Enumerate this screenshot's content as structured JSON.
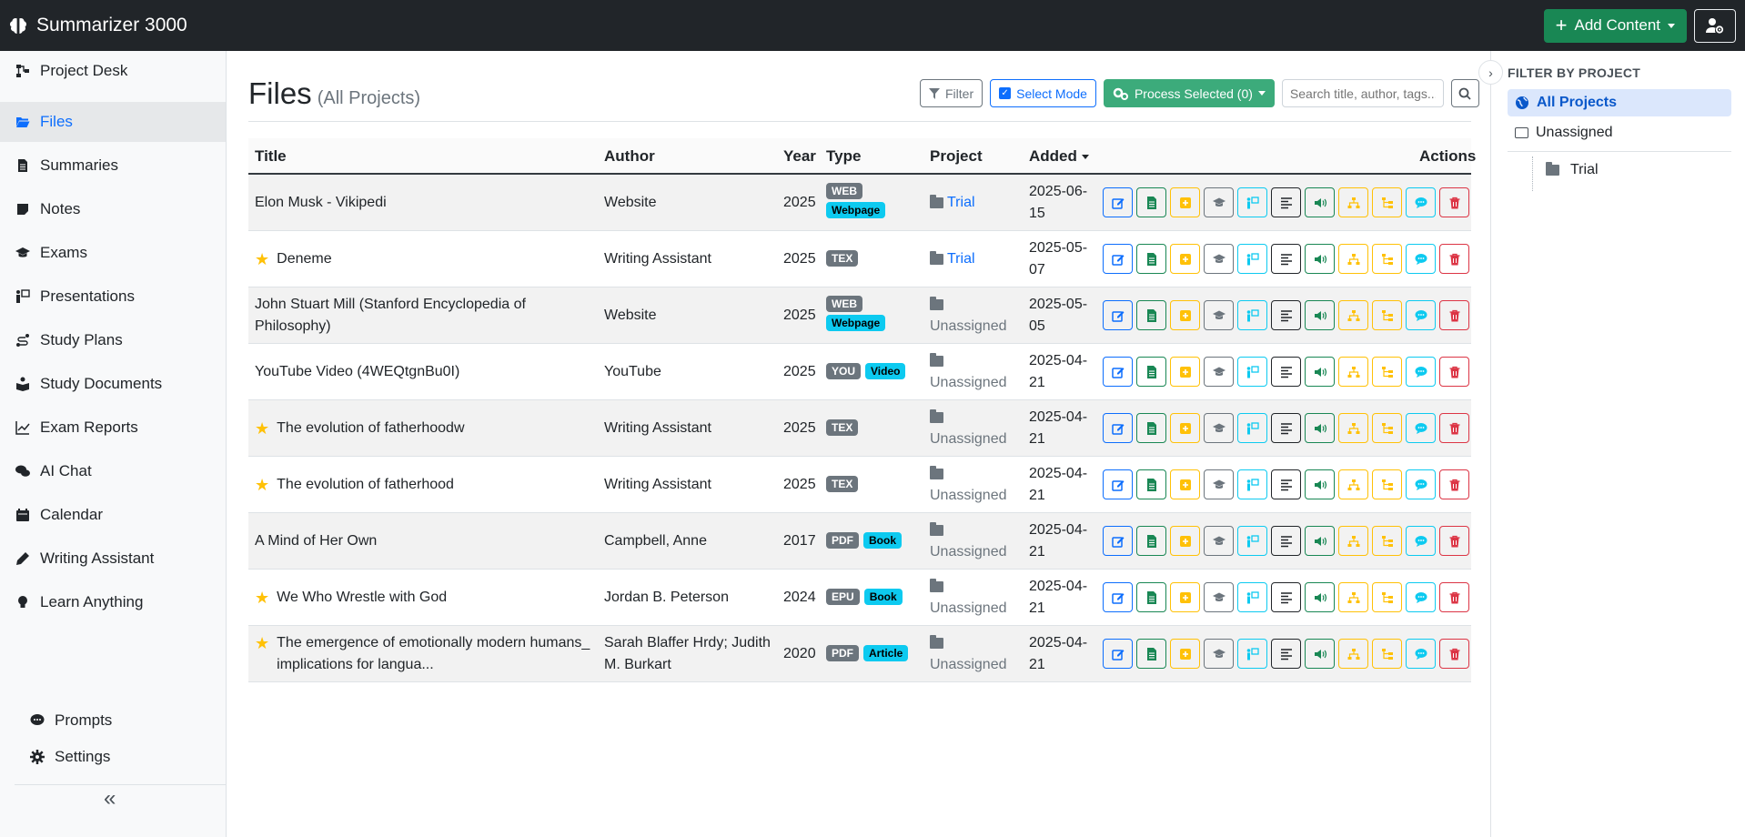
{
  "app": {
    "title": "Summarizer 3000",
    "add_content_label": "Add Content"
  },
  "sidebar": {
    "items": [
      {
        "label": "Project Desk",
        "icon": "diagram-icon"
      },
      {
        "label": "Files",
        "icon": "folder-open-icon",
        "active": true
      },
      {
        "label": "Summaries",
        "icon": "file-text-icon"
      },
      {
        "label": "Notes",
        "icon": "sticky-note-icon"
      },
      {
        "label": "Exams",
        "icon": "graduation-cap-icon"
      },
      {
        "label": "Presentations",
        "icon": "presentation-icon"
      },
      {
        "label": "Study Plans",
        "icon": "route-icon"
      },
      {
        "label": "Study Documents",
        "icon": "book-reader-icon"
      },
      {
        "label": "Exam Reports",
        "icon": "chart-line-icon"
      },
      {
        "label": "AI Chat",
        "icon": "comments-icon"
      },
      {
        "label": "Calendar",
        "icon": "calendar-icon"
      },
      {
        "label": "Writing Assistant",
        "icon": "pen-icon"
      },
      {
        "label": "Learn Anything",
        "icon": "lightbulb-icon"
      }
    ],
    "bottom": {
      "prompts": "Prompts",
      "settings": "Settings"
    }
  },
  "page": {
    "title": "Files",
    "subtitle": "(All Projects)"
  },
  "toolbar": {
    "filter_label": "Filter",
    "select_mode_label": "Select Mode",
    "process_label": "Process Selected (0)",
    "search_placeholder": "Search title, author, tags..."
  },
  "table": {
    "headers": {
      "title": "Title",
      "author": "Author",
      "year": "Year",
      "type": "Type",
      "project": "Project",
      "added": "Added",
      "actions": "Actions"
    },
    "rows": [
      {
        "title": "Elon Musk - Vikipedi",
        "starred": false,
        "author": "Website",
        "year": "2025",
        "badges": [
          {
            "text": "WEB",
            "style": "gray"
          },
          {
            "text": "Webpage",
            "style": "cyan"
          }
        ],
        "badge_layout": "stack",
        "project": "Trial",
        "project_linked": true,
        "added": "2025-06-15"
      },
      {
        "title": "Deneme",
        "starred": true,
        "author": "Writing Assistant",
        "year": "2025",
        "badges": [
          {
            "text": "TEX",
            "style": "gray"
          }
        ],
        "badge_layout": "row",
        "project": "Trial",
        "project_linked": true,
        "added": "2025-05-07"
      },
      {
        "title": "John Stuart Mill (Stanford Encyclopedia of Philosophy)",
        "starred": false,
        "author": "Website",
        "year": "2025",
        "badges": [
          {
            "text": "WEB",
            "style": "gray"
          },
          {
            "text": "Webpage",
            "style": "cyan"
          }
        ],
        "badge_layout": "stack",
        "project": "Unassigned",
        "project_linked": false,
        "added": "2025-05-05"
      },
      {
        "title": "YouTube Video (4WEQtgnBu0I)",
        "starred": false,
        "author": "YouTube",
        "year": "2025",
        "badges": [
          {
            "text": "YOU",
            "style": "gray"
          },
          {
            "text": "Video",
            "style": "cyan"
          }
        ],
        "badge_layout": "row",
        "project": "Unassigned",
        "project_linked": false,
        "added": "2025-04-21"
      },
      {
        "title": "The evolution of fatherhoodw",
        "starred": true,
        "author": "Writing Assistant",
        "year": "2025",
        "badges": [
          {
            "text": "TEX",
            "style": "gray"
          }
        ],
        "badge_layout": "row",
        "project": "Unassigned",
        "project_linked": false,
        "added": "2025-04-21"
      },
      {
        "title": "The evolution of fatherhood",
        "starred": true,
        "author": "Writing Assistant",
        "year": "2025",
        "badges": [
          {
            "text": "TEX",
            "style": "gray"
          }
        ],
        "badge_layout": "row",
        "project": "Unassigned",
        "project_linked": false,
        "added": "2025-04-21"
      },
      {
        "title": "A Mind of Her Own",
        "starred": false,
        "author": "Campbell, Anne",
        "year": "2017",
        "badges": [
          {
            "text": "PDF",
            "style": "gray"
          },
          {
            "text": "Book",
            "style": "cyan"
          }
        ],
        "badge_layout": "row",
        "project": "Unassigned",
        "project_linked": false,
        "added": "2025-04-21"
      },
      {
        "title": "We Who Wrestle with God",
        "starred": true,
        "author": "Jordan B. Peterson",
        "year": "2024",
        "badges": [
          {
            "text": "EPU",
            "style": "gray"
          },
          {
            "text": "Book",
            "style": "cyan"
          }
        ],
        "badge_layout": "row",
        "project": "Unassigned",
        "project_linked": false,
        "added": "2025-04-21"
      },
      {
        "title": "The emergence of emotionally modern humans_ implications for langua...",
        "starred": true,
        "author": "Sarah Blaffer Hrdy; Judith M. Burkart",
        "year": "2020",
        "badges": [
          {
            "text": "PDF",
            "style": "gray"
          },
          {
            "text": "Article",
            "style": "cyan"
          }
        ],
        "badge_layout": "row",
        "project": "Unassigned",
        "project_linked": false,
        "added": "2025-04-21"
      }
    ],
    "actions": [
      {
        "name": "edit-icon",
        "color": "#0d6efd"
      },
      {
        "name": "summary-icon",
        "color": "#198754"
      },
      {
        "name": "note-icon",
        "color": "#ffc107"
      },
      {
        "name": "exam-icon",
        "color": "#6c757d"
      },
      {
        "name": "presentation-icon",
        "color": "#0dcaf0"
      },
      {
        "name": "text-align-icon",
        "color": "#212529"
      },
      {
        "name": "audio-icon",
        "color": "#198754"
      },
      {
        "name": "mindmap-icon",
        "color": "#ffc107"
      },
      {
        "name": "outline-icon",
        "color": "#ffc107"
      },
      {
        "name": "chat-icon",
        "color": "#0dcaf0"
      },
      {
        "name": "trash-icon",
        "color": "#dc3545"
      }
    ]
  },
  "filter_panel": {
    "title": "FILTER BY PROJECT",
    "items": [
      {
        "label": "All Projects",
        "active": true
      },
      {
        "label": "Unassigned"
      },
      {
        "label": "Trial"
      }
    ]
  }
}
